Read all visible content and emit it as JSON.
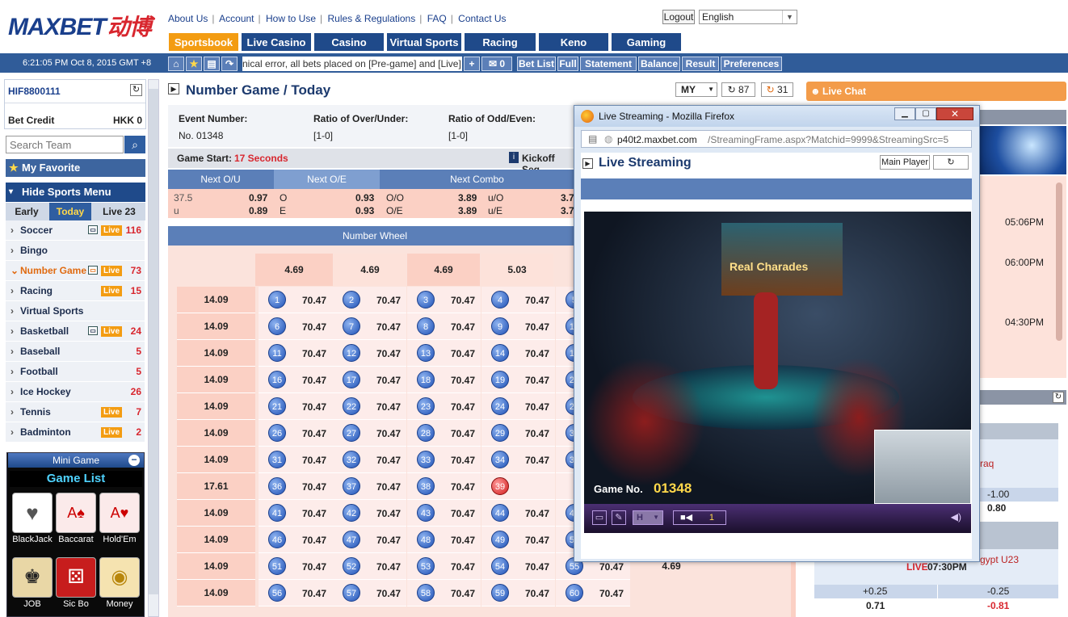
{
  "header": {
    "logo_text": "MAXBET",
    "logo_cn": "动博",
    "links": [
      "About Us",
      "Account",
      "How to Use",
      "Rules & Regulations",
      "FAQ",
      "Contact Us"
    ],
    "logout": "Logout",
    "language": "English",
    "clock": "6:21:05 PM Oct 8, 2015 GMT +8",
    "ticker": "nical error, all bets placed on [Pre-game] and [Live] [Nu",
    "msg_count": "0"
  },
  "tabs": [
    "Sportsbook",
    "Live Casino",
    "Casino",
    "Virtual Sports",
    "Racing",
    "Keno",
    "Gaming"
  ],
  "toolbar": [
    "Bet List",
    "Full",
    "Statement",
    "Balance",
    "Result",
    "Preferences"
  ],
  "account": {
    "username": "HIF8800111",
    "bet_credit_label": "Bet Credit",
    "bet_credit_value": "HKK 0"
  },
  "search": {
    "placeholder": "Search Team"
  },
  "favorite": "My Favorite",
  "hide_menu": "Hide Sports Menu",
  "periods": [
    {
      "label": "Early"
    },
    {
      "label": "Today"
    },
    {
      "label": "Live 23"
    }
  ],
  "sports": [
    {
      "name": "Soccer",
      "live": "Live",
      "count": "116"
    },
    {
      "name": "Bingo",
      "live": "",
      "count": ""
    },
    {
      "name": "Number Game",
      "live": "Live",
      "count": "73"
    },
    {
      "name": "Racing",
      "live": "Live",
      "count": "15"
    },
    {
      "name": "Virtual Sports",
      "live": "",
      "count": ""
    },
    {
      "name": "Basketball",
      "live": "Live",
      "count": "24"
    },
    {
      "name": "Baseball",
      "live": "",
      "count": "5"
    },
    {
      "name": "Football",
      "live": "",
      "count": "5"
    },
    {
      "name": "Ice Hockey",
      "live": "",
      "count": "26"
    },
    {
      "name": "Tennis",
      "live": "Live",
      "count": "7"
    },
    {
      "name": "Badminton",
      "live": "Live",
      "count": "2"
    }
  ],
  "minigame": {
    "title": "Mini Game",
    "list_title": "Game List",
    "games": [
      {
        "name": "BlackJack"
      },
      {
        "name": "Baccarat"
      },
      {
        "name": "Hold'Em"
      },
      {
        "name": "JOB"
      },
      {
        "name": "Sic Bo"
      },
      {
        "name": "Money"
      }
    ]
  },
  "main": {
    "title": "Number Game / Today",
    "odds_type": "MY",
    "refresh1": "87",
    "refresh2": "31",
    "event_number_label": "Event Number:",
    "event_number": "No. 01348",
    "ou_label": "Ratio of Over/Under:",
    "ou_value": "[1-0]",
    "oe_label": "Ratio of Odd/Even:",
    "oe_value": "[1-0]",
    "game_start_label": "Game Start:",
    "game_start_value": "17 Seconds",
    "kickoff": "Kickoff Seq",
    "col_headers": [
      "Next O/U",
      "Next O/E",
      "Next Combo"
    ],
    "ou_rows": [
      {
        "label": "37.5",
        "odd": "0.97"
      },
      {
        "label": "u",
        "odd": "0.89"
      }
    ],
    "oe_rows": [
      {
        "label": "O",
        "odd": "0.93"
      },
      {
        "label": "E",
        "odd": "0.93"
      }
    ],
    "combo_rows": [
      {
        "a": "O/O",
        "av": "3.89",
        "b": "u/O",
        "bv": "3.7"
      },
      {
        "a": "O/E",
        "av": "3.89",
        "b": "u/E",
        "bv": "3.7"
      }
    ],
    "wheel_title": "Number Wheel",
    "wheel_col_odds": [
      "4.69",
      "4.69",
      "4.69",
      "5.03"
    ],
    "wheel_rows": [
      {
        "odd": "14.09",
        "balls": [
          "1",
          "2",
          "3",
          "4",
          "5"
        ]
      },
      {
        "odd": "14.09",
        "balls": [
          "6",
          "7",
          "8",
          "9",
          "10"
        ]
      },
      {
        "odd": "14.09",
        "balls": [
          "11",
          "12",
          "13",
          "14",
          "15"
        ]
      },
      {
        "odd": "14.09",
        "balls": [
          "16",
          "17",
          "18",
          "19",
          "20"
        ]
      },
      {
        "odd": "14.09",
        "balls": [
          "21",
          "22",
          "23",
          "24",
          "25"
        ]
      },
      {
        "odd": "14.09",
        "balls": [
          "26",
          "27",
          "28",
          "29",
          "30"
        ]
      },
      {
        "odd": "14.09",
        "balls": [
          "31",
          "32",
          "33",
          "34",
          "35"
        ]
      },
      {
        "odd": "17.61",
        "balls": [
          "36",
          "37",
          "38",
          "39",
          ""
        ]
      },
      {
        "odd": "14.09",
        "balls": [
          "41",
          "42",
          "43",
          "44",
          "45"
        ]
      },
      {
        "odd": "14.09",
        "balls": [
          "46",
          "47",
          "48",
          "49",
          "50"
        ]
      },
      {
        "odd": "14.09",
        "balls": [
          "51",
          "52",
          "53",
          "54",
          "55"
        ]
      },
      {
        "odd": "14.09",
        "balls": [
          "56",
          "57",
          "58",
          "59",
          "60"
        ]
      }
    ],
    "ball_odd": "70.47",
    "extra_odd": "4.69"
  },
  "right": {
    "live_chat": "Live Chat",
    "times": [
      "05:06PM",
      "06:00PM",
      "04:30PM"
    ],
    "team1": "raq",
    "val1": "-1.00",
    "val2": "0.80",
    "team2": "gypt U23",
    "live_label": "LIVE",
    "live_time": "07:30PM",
    "h1": "+0.25",
    "h2": "-0.25",
    "o1": "0.71",
    "o2": "-0.81"
  },
  "stream": {
    "window_title": "Live Streaming - Mozilla Firefox",
    "url_host": "p40t2.maxbet.com",
    "url_path": "/StreamingFrame.aspx?Matchid=9999&StreamingSrc=5",
    "heading": "Live Streaming",
    "main_player": "Main Player",
    "screen_text": "Real Charades",
    "game_no_label": "Game No.",
    "game_no": "01348",
    "quality": "H",
    "viewers": "1"
  }
}
